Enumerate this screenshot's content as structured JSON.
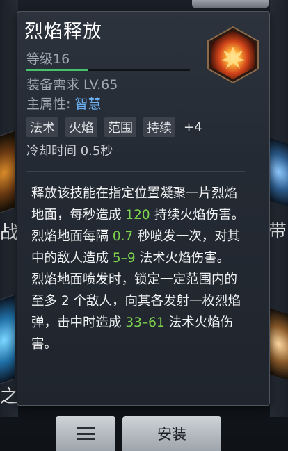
{
  "skill": {
    "name": "烈焰释放",
    "level": "等级16",
    "xp_progress": 0.38,
    "requirement": "装备需求 LV.65",
    "main_attr_label": "主属性:",
    "main_attr_value": "智慧",
    "tags": [
      "法术",
      "火焰",
      "范围",
      "持续"
    ],
    "tags_more": "+4",
    "cooldown": "冷却时间 0.5秒",
    "icon": "fire-burst-icon"
  },
  "description": {
    "p1": {
      "a": "释放该技能在指定位置凝聚一片烈焰地面，每秒造成 ",
      "n1": "120",
      "b": " 持续火焰伤害。"
    },
    "p2": {
      "a": "烈焰地面每隔 ",
      "n1": "0.7",
      "b": " 秒喷发一次，对其中的敌人造成 ",
      "n2": "5–9",
      "c": " 法术火焰伤害。"
    },
    "p3": {
      "a": "烈焰地面喷发时，锁定一定范围内的至多 2 个敌人，向其各发射一枚烈焰弹，击中时造成 ",
      "n1": "33–61",
      "b": " 法术火焰伤害。"
    }
  },
  "buttons": {
    "menu_icon": "menu-icon",
    "install_label": "安装"
  },
  "background": {
    "left_char_1": "战",
    "left_char_2": "之",
    "right_char_1": "带"
  },
  "colors": {
    "number_highlight": "#7fd34e",
    "attr_value": "#6ab0f3",
    "xp_fill": "#46c26a"
  }
}
